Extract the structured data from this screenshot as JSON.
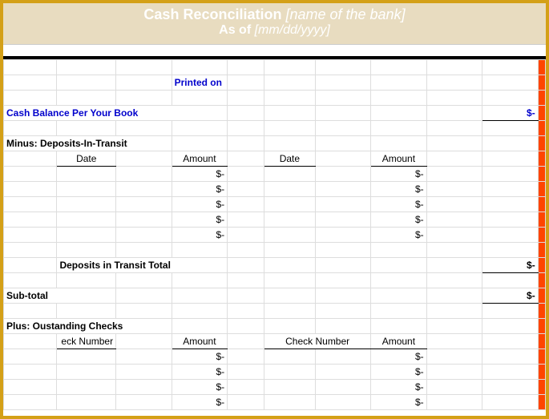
{
  "header": {
    "title_prefix": "Cash Reconciliation ",
    "title_bracket": "[name of the bank]",
    "sub_prefix": "As of ",
    "sub_bracket": "[mm/dd/yyyy]"
  },
  "labels": {
    "printed_on": "Printed on",
    "cash_balance": "Cash Balance Per Your Book",
    "minus_deposits": "Minus: Deposits-In-Transit",
    "date": "Date",
    "amount": "Amount",
    "deposits_total": "Deposits in Transit Total",
    "subtotal": "Sub-total",
    "plus_outstanding": "Plus: Oustanding Checks",
    "check_number_cut": "eck Number",
    "check_number": "Check Number"
  },
  "values": {
    "dash": "$-"
  }
}
